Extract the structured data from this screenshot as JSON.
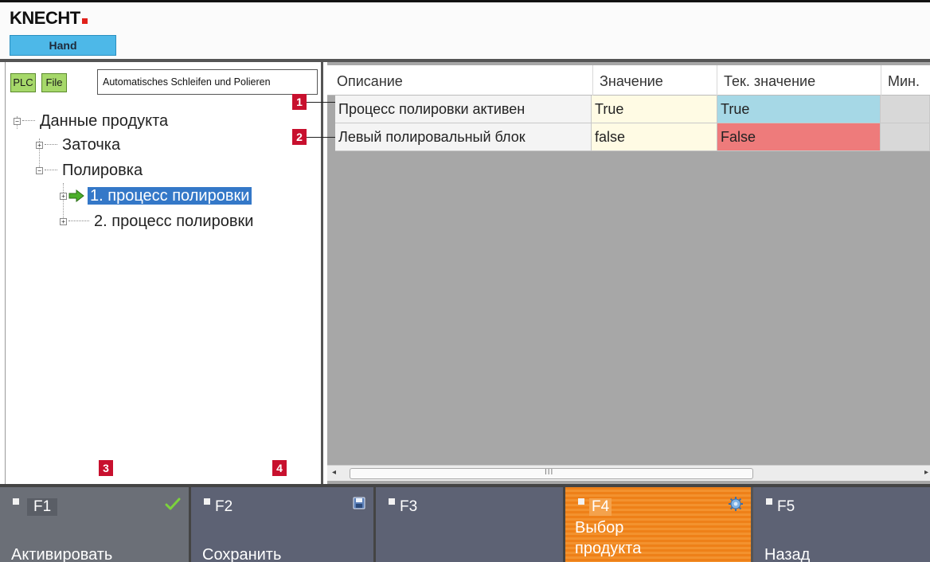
{
  "header": {
    "logo_text": "KNECHT",
    "mode": "Hand",
    "brand_color": "#e0201a",
    "mode_color": "#4db8e8"
  },
  "left_panel": {
    "plc_button": "PLC",
    "file_button": "File",
    "program_name": "Automatisches Schleifen und Polieren",
    "tree": [
      {
        "label": "Данные продукта",
        "level": 0,
        "expander": "⊟"
      },
      {
        "label": "Заточка",
        "level": 1,
        "expander": "⊞"
      },
      {
        "label": "Полировка",
        "level": 1,
        "expander": "⊟"
      },
      {
        "label": "1. процесс полировки",
        "level": 2,
        "expander": "⊞",
        "selected": true,
        "icon": "green-arrow-icon"
      },
      {
        "label": "2. процесс полировки",
        "level": 2,
        "expander": "⊞"
      }
    ]
  },
  "grid": {
    "columns": [
      "Описание",
      "Значение",
      "Тек. значение",
      "Мин."
    ],
    "rows": [
      {
        "description": "Процесс полировки активен",
        "value": "True",
        "current": "True",
        "current_state": "ok"
      },
      {
        "description": "Левый полировальный блок",
        "value": "false",
        "current": "False",
        "current_state": "error"
      }
    ],
    "colors": {
      "current_ok": "#a6d8e6",
      "current_error": "#ee7b7b",
      "value_bg": "#fffbe4"
    },
    "scrollbar": {
      "left_arrow": "◂",
      "right_arrow": "▸",
      "grip": "III"
    }
  },
  "markers": [
    "1",
    "2",
    "3",
    "4"
  ],
  "function_keys": [
    {
      "key": "F1",
      "action": "Активировать",
      "icon": "checkmark-icon"
    },
    {
      "key": "F2",
      "action": "Сохранить",
      "icon": "save-icon"
    },
    {
      "key": "F3",
      "action": ""
    },
    {
      "key": "F4",
      "action_line1": "Выбор",
      "action_line2": "продукта",
      "icon": "gear-icon",
      "active": true
    },
    {
      "key": "F5",
      "action": "Назад"
    }
  ],
  "accent_color": "#ee8018"
}
